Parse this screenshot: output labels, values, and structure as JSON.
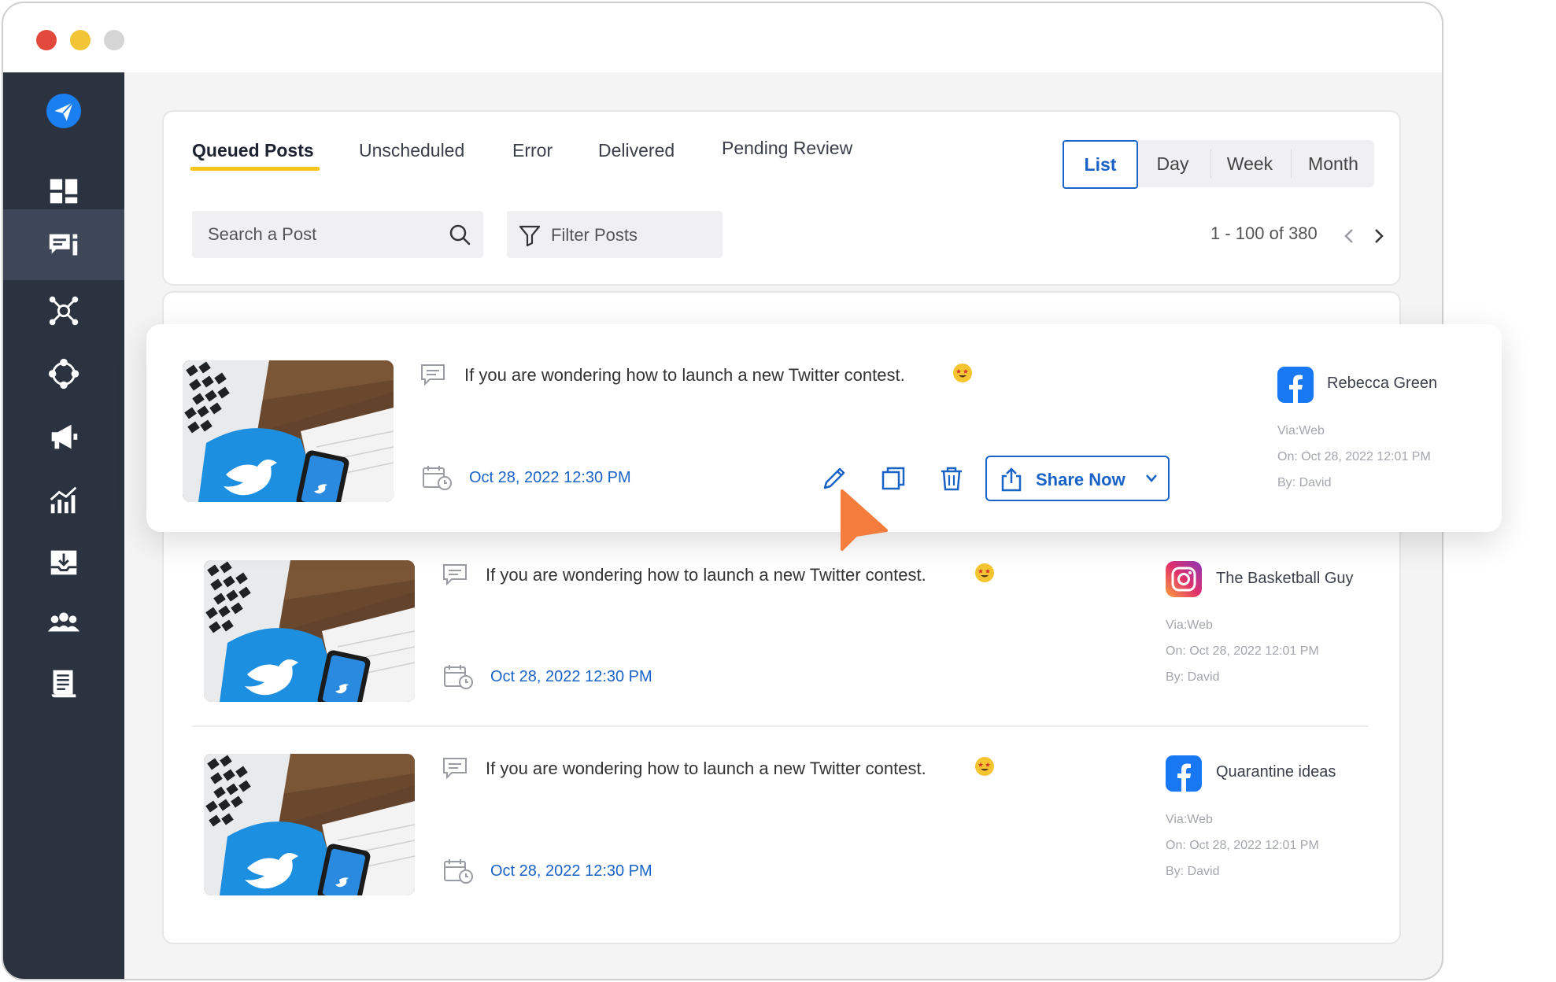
{
  "colors": {
    "accent": "#1a63c6",
    "tab_underline": "#f5c518",
    "sidebar_bg": "#2b3340",
    "facebook": "#1877f2",
    "cursor": "#f47c3c"
  },
  "sidebar": {
    "items": [
      {
        "icon": "paper-plane-logo-icon"
      },
      {
        "icon": "dashboard-grid-icon"
      },
      {
        "icon": "posts-queue-icon",
        "active": true
      },
      {
        "icon": "network-hub-icon"
      },
      {
        "icon": "connect-cycle-icon"
      },
      {
        "icon": "megaphone-icon"
      },
      {
        "icon": "analytics-bars-icon"
      },
      {
        "icon": "inbox-download-icon"
      },
      {
        "icon": "team-users-icon"
      },
      {
        "icon": "report-document-icon"
      }
    ]
  },
  "tabs": [
    "Queued Posts",
    "Unscheduled",
    "Error",
    "Delivered",
    "Pending Review"
  ],
  "active_tab": "Queued Posts",
  "views": [
    "List",
    "Day",
    "Week",
    "Month"
  ],
  "active_view": "List",
  "search": {
    "placeholder": "Search a Post"
  },
  "filter": {
    "label": "Filter Posts"
  },
  "pagination": {
    "range": "1 - 100 of 380"
  },
  "posts": [
    {
      "text": "If you are wondering how to launch a new Twitter contest.",
      "emoji": "star-struck-emoji",
      "date": "Oct 28, 2022 12:30 PM",
      "network": "facebook",
      "account": "Rebecca Green",
      "via": "Via:Web",
      "on": "On: Oct 28, 2022 12:01 PM",
      "by": "By: David"
    },
    {
      "text": "If you are wondering how to launch a new Twitter contest.",
      "emoji": "star-struck-emoji",
      "date": "Oct 28, 2022 12:30 PM",
      "network": "instagram",
      "account": "The Basketball Guy",
      "via": "Via:Web",
      "on": "On: Oct 28, 2022 12:01 PM",
      "by": "By: David"
    },
    {
      "text": "If you are wondering how to launch a new Twitter contest.",
      "emoji": "star-struck-emoji",
      "date": "Oct 28, 2022 12:30 PM",
      "network": "facebook",
      "account": "Quarantine ideas",
      "via": "Via:Web",
      "on": "On: Oct 28, 2022 12:01 PM",
      "by": "By: David"
    }
  ],
  "actions": {
    "share_label": "Share Now"
  }
}
